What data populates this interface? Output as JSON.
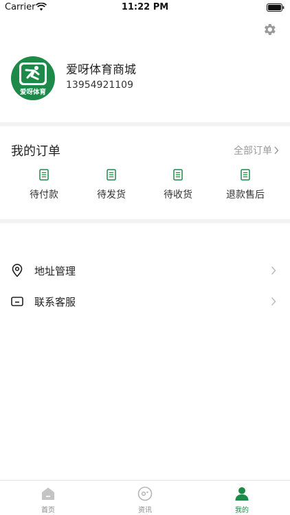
{
  "status_bar": {
    "carrier": "Carrier",
    "time": "11:22 PM"
  },
  "profile": {
    "avatar_text": "爱呀体育",
    "name": "爱呀体育商城",
    "phone": "13954921109"
  },
  "orders": {
    "title": "我的订单",
    "view_all": "全部订单",
    "items": [
      {
        "label": "待付款",
        "icon": "doc-icon"
      },
      {
        "label": "待发货",
        "icon": "doc-icon"
      },
      {
        "label": "待收货",
        "icon": "doc-icon"
      },
      {
        "label": "退款售后",
        "icon": "doc-icon"
      }
    ]
  },
  "menu": [
    {
      "label": "地址管理",
      "icon": "location-pin-icon"
    },
    {
      "label": "联系客服",
      "icon": "message-box-icon"
    }
  ],
  "tabs": [
    {
      "label": "首页",
      "icon": "home-icon",
      "active": false
    },
    {
      "label": "资讯",
      "icon": "news-icon",
      "active": false
    },
    {
      "label": "我的",
      "icon": "user-icon",
      "active": true
    }
  ],
  "colors": {
    "accent": "#1e8a4a",
    "inactive": "#aaaaaa",
    "separator": "#f2f2f2"
  }
}
